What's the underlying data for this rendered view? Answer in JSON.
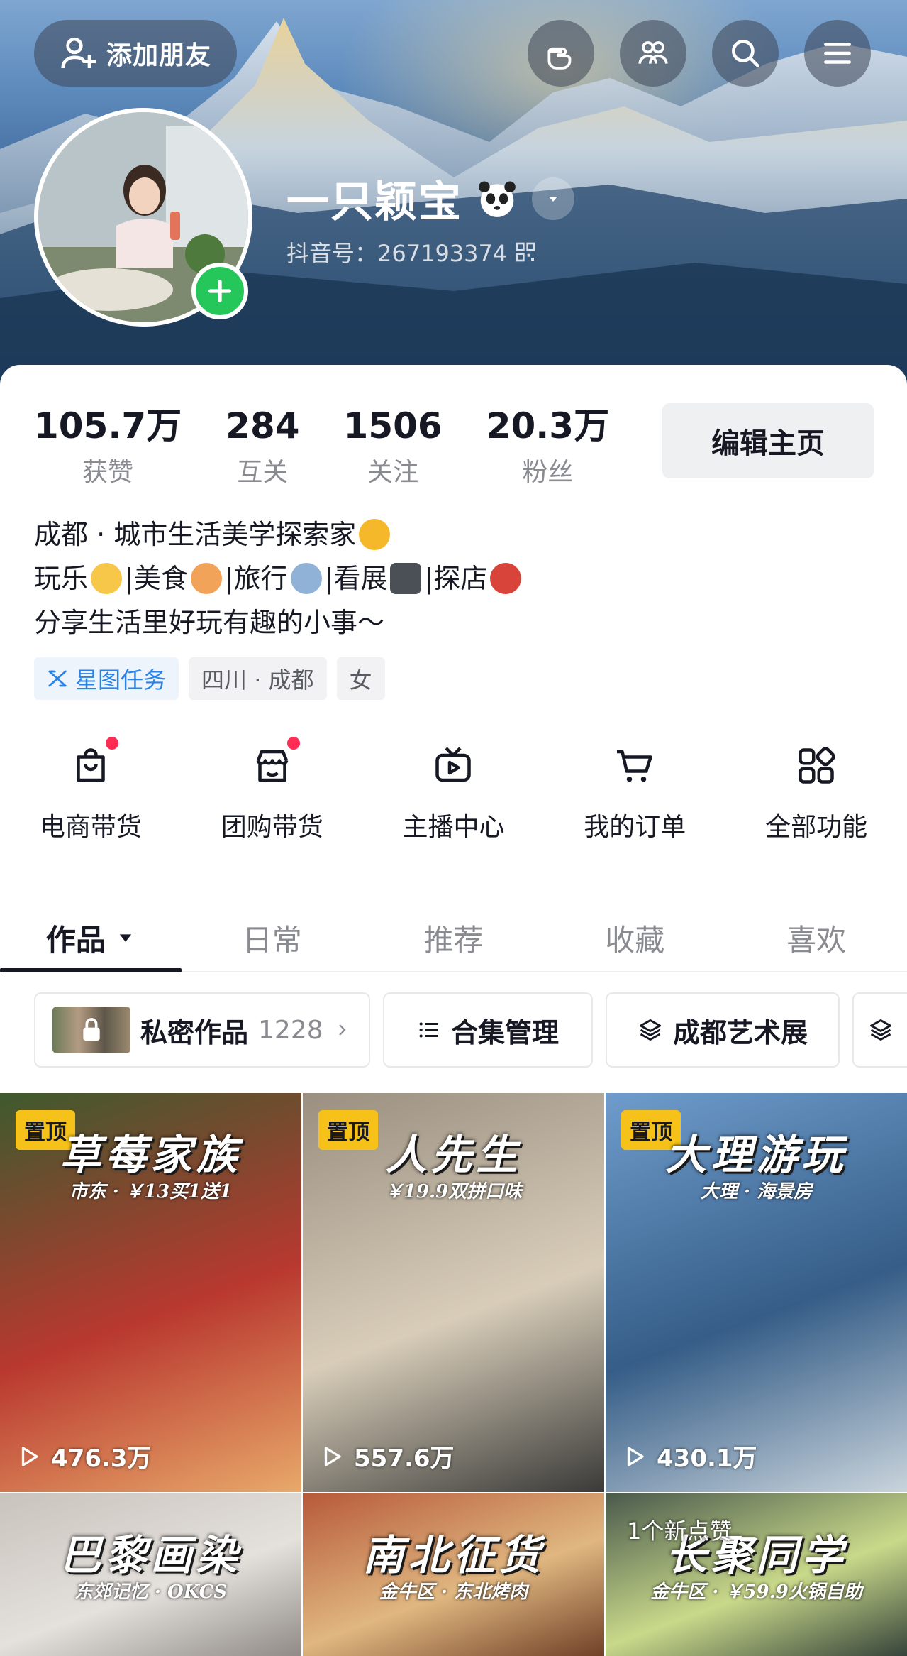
{
  "header": {
    "add_friend_label": "添加朋友",
    "nickname": "一只颖宝",
    "douyin_id": "抖音号：267193374"
  },
  "stats": [
    {
      "value": "105.7万",
      "label": "获赞"
    },
    {
      "value": "284",
      "label": "互关"
    },
    {
      "value": "1506",
      "label": "关注"
    },
    {
      "value": "20.3万",
      "label": "粉丝"
    }
  ],
  "edit_profile_label": "编辑主页",
  "bio": {
    "line1": "成都 · 城市生活美学探索家",
    "line2": [
      "玩乐",
      "|美食",
      "|旅行",
      "|看展",
      "|探店"
    ],
    "line3": "分享生活里好玩有趣的小事～"
  },
  "tags": [
    "星图任务",
    "四川 · 成都",
    "女"
  ],
  "features": [
    {
      "label": "电商带货",
      "icon": "shopping-bag-icon",
      "badge": true
    },
    {
      "label": "团购带货",
      "icon": "store-icon",
      "badge": true
    },
    {
      "label": "主播中心",
      "icon": "tv-play-icon",
      "badge": false
    },
    {
      "label": "我的订单",
      "icon": "cart-icon",
      "badge": false
    },
    {
      "label": "全部功能",
      "icon": "grid-icon",
      "badge": false
    }
  ],
  "tabs": [
    "作品",
    "日常",
    "推荐",
    "收藏",
    "喜欢"
  ],
  "chips": {
    "private": {
      "label": "私密作品",
      "count": "1228"
    },
    "collection": "合集管理",
    "art": "成都艺术展"
  },
  "pinned_label": "置顶",
  "videos": [
    {
      "title": "草莓家族",
      "subtitle": "市东 · ￥13买1送1",
      "plays": "476.3万",
      "pinned": true,
      "colors": [
        "#3e5a2e",
        "#b9382f",
        "#e8a96a"
      ]
    },
    {
      "title": "人先生",
      "subtitle": "￥19.9双拼口味",
      "plays": "557.6万",
      "pinned": true,
      "colors": [
        "#9a8f80",
        "#d8cdb9",
        "#3a3a38"
      ]
    },
    {
      "title": "大理游玩",
      "subtitle": "大理 · 海景房",
      "plays": "430.1万",
      "pinned": true,
      "colors": [
        "#6f9ccc",
        "#355d87",
        "#c9d4dc"
      ]
    },
    {
      "title": "巴黎画染",
      "subtitle": "东郊记忆 · OKCS",
      "plays": "",
      "pinned": false,
      "colors": [
        "#c9c3bd",
        "#e4e0dc",
        "#8b8682"
      ]
    },
    {
      "title": "南北征货",
      "subtitle": "金牛区 · 东北烤肉",
      "plays": "",
      "pinned": false,
      "colors": [
        "#b75a3a",
        "#e0b780",
        "#6a3a22"
      ]
    },
    {
      "title": "长聚同学",
      "subtitle": "金牛区 · ￥59.9火锅自助",
      "plays": "",
      "pinned": false,
      "overlay": "1个新点赞",
      "colors": [
        "#4a5a4c",
        "#c9d98a",
        "#2e3b36"
      ]
    }
  ],
  "colors": {
    "accent": "#fe2c55",
    "pin": "#f6c21a",
    "plus": "#25c75a",
    "tag_blue": "#2a83e6"
  }
}
